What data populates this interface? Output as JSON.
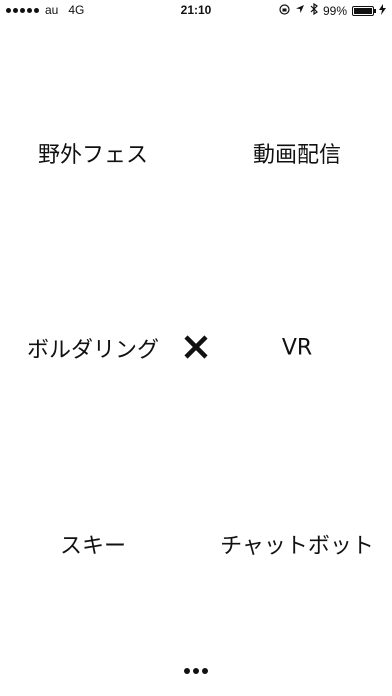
{
  "status_bar": {
    "carrier": "au",
    "network": "4G",
    "time": "21:10",
    "battery_text": "99%",
    "battery_level": 0.99
  },
  "words": {
    "top_left": "野外フェス",
    "top_right": "動画配信",
    "middle_left": "ボルダリング",
    "middle_right": "VR",
    "bottom_left": "スキー",
    "bottom_right": "チャットボット"
  },
  "icons": {
    "combine": "cross-icon",
    "more": "more-dots-icon"
  }
}
